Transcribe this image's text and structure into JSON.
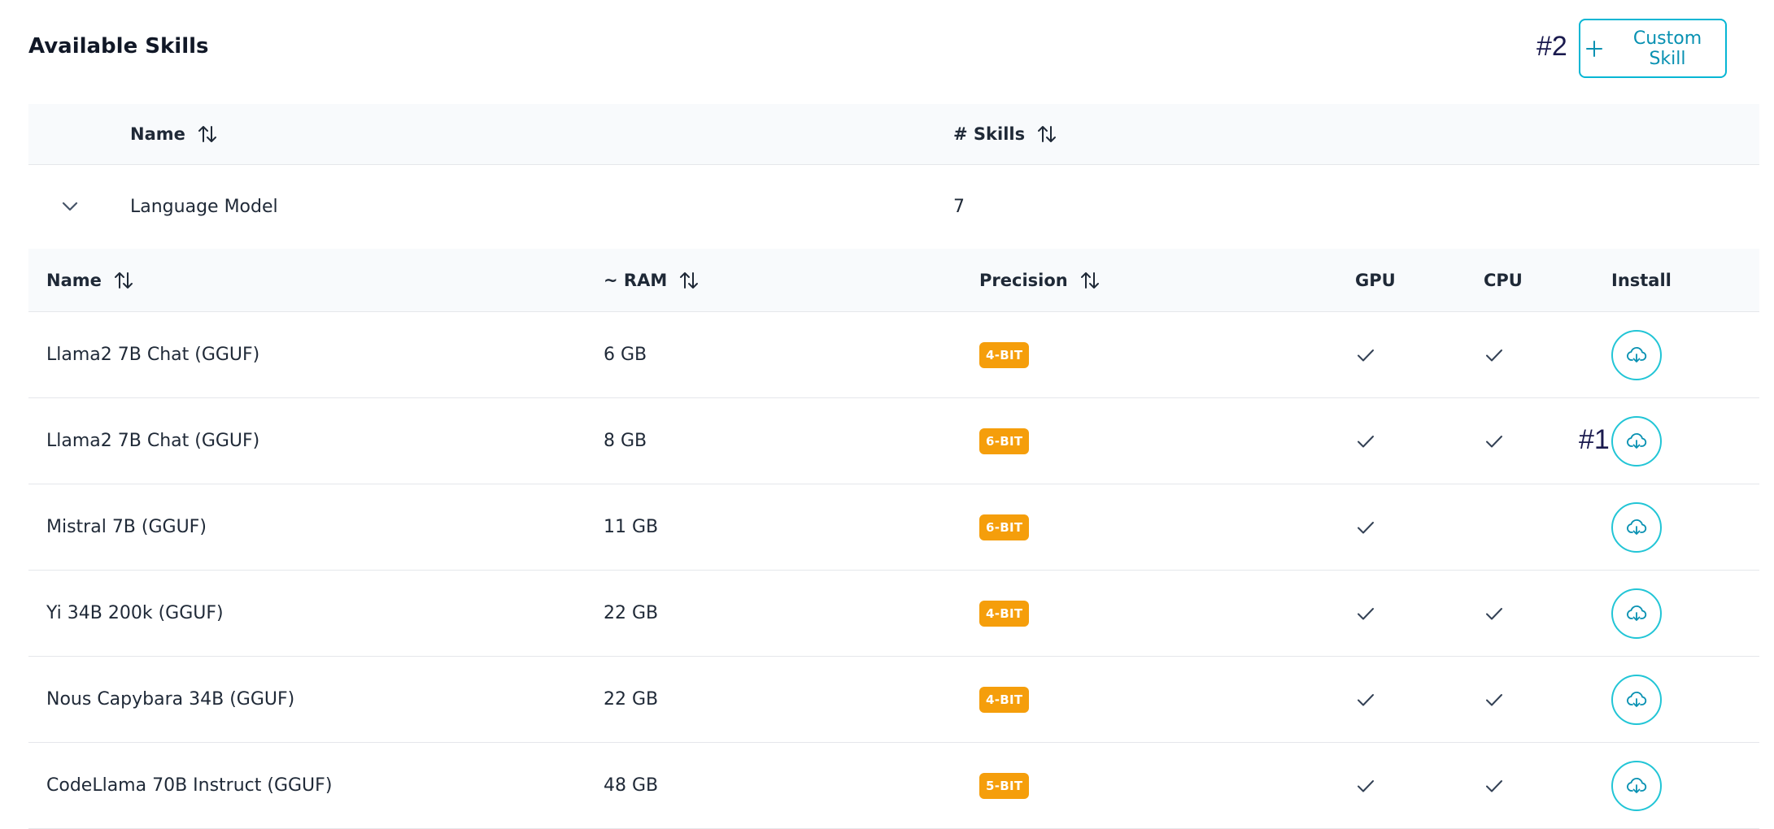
{
  "header": {
    "title": "Available Skills",
    "custom_skill_label": "Custom Skill",
    "annotation_2": "#2"
  },
  "outer_table": {
    "columns": [
      "Name",
      "# Skills"
    ],
    "group": {
      "name": "Language Model",
      "count": "7"
    }
  },
  "inner_table": {
    "columns": [
      "Name",
      "~ RAM",
      "Precision",
      "GPU",
      "CPU",
      "Install"
    ],
    "rows": [
      {
        "name": "Llama2 7B Chat (GGUF)",
        "ram": "6 GB",
        "precision": "4-BIT",
        "gpu": true,
        "cpu": true
      },
      {
        "name": "Llama2 7B Chat (GGUF)",
        "ram": "8 GB",
        "precision": "6-BIT",
        "gpu": true,
        "cpu": true
      },
      {
        "name": "Mistral 7B (GGUF)",
        "ram": "11 GB",
        "precision": "6-BIT",
        "gpu": true,
        "cpu": false
      },
      {
        "name": "Yi 34B 200k (GGUF)",
        "ram": "22 GB",
        "precision": "4-BIT",
        "gpu": true,
        "cpu": true
      },
      {
        "name": "Nous Capybara 34B (GGUF)",
        "ram": "22 GB",
        "precision": "4-BIT",
        "gpu": true,
        "cpu": true
      },
      {
        "name": "CodeLlama 70B Instruct (GGUF)",
        "ram": "48 GB",
        "precision": "5-BIT",
        "gpu": true,
        "cpu": true
      }
    ],
    "annotation_1": "#1"
  },
  "icons": [
    "plus-icon",
    "sort-icon",
    "chevron-down-icon",
    "check-icon",
    "cloud-download-icon"
  ],
  "colors": {
    "accent": "#06b6d4",
    "badge": "#f59e0b",
    "header_bg": "#f8fafc"
  }
}
